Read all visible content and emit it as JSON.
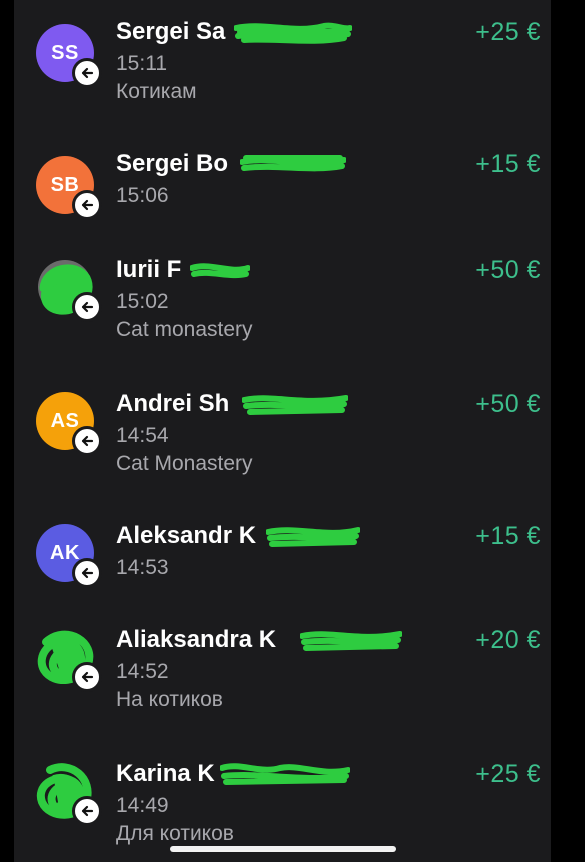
{
  "transactions": [
    {
      "avatar_initials": "SS",
      "avatar_color": "#7f5af0",
      "name": "Sergei Sa",
      "time": "15:11",
      "note": "Котикам",
      "amount": "+25 €",
      "direction_icon": "incoming-arrow-icon"
    },
    {
      "avatar_initials": "SB",
      "avatar_color": "#f2723a",
      "name": "Sergei Bo",
      "time": "15:06",
      "note": "",
      "amount": "+15 €",
      "direction_icon": "incoming-arrow-icon"
    },
    {
      "avatar_initials": "",
      "avatar_color": "#2ecc40",
      "name": "Iurii F",
      "time": "15:02",
      "note": "Cat monastery",
      "amount": "+50 €",
      "direction_icon": "incoming-arrow-icon"
    },
    {
      "avatar_initials": "AS",
      "avatar_color": "#f5a10a",
      "name": "Andrei Sh",
      "time": "14:54",
      "note": "Cat Monastery",
      "amount": "+50 €",
      "direction_icon": "incoming-arrow-icon"
    },
    {
      "avatar_initials": "AK",
      "avatar_color": "#5b5ce2",
      "name": "Aleksandr K",
      "time": "14:53",
      "note": "",
      "amount": "+15 €",
      "direction_icon": "incoming-arrow-icon"
    },
    {
      "avatar_initials": "",
      "avatar_color": "#2ecc40",
      "name": "Aliaksandra K",
      "time": "14:52",
      "note": "На котиков",
      "amount": "+20 €",
      "direction_icon": "incoming-arrow-icon"
    },
    {
      "avatar_initials": "",
      "avatar_color": "#2ecc40",
      "name": "Karina K",
      "time": "14:49",
      "note": "Для котиков",
      "amount": "+25 €",
      "direction_icon": "incoming-arrow-icon"
    }
  ],
  "colors": {
    "background": "#1b1b1d",
    "amount_positive": "#3dbf8c",
    "secondary_text": "#a8a8ad",
    "redaction": "#2ecc40"
  }
}
